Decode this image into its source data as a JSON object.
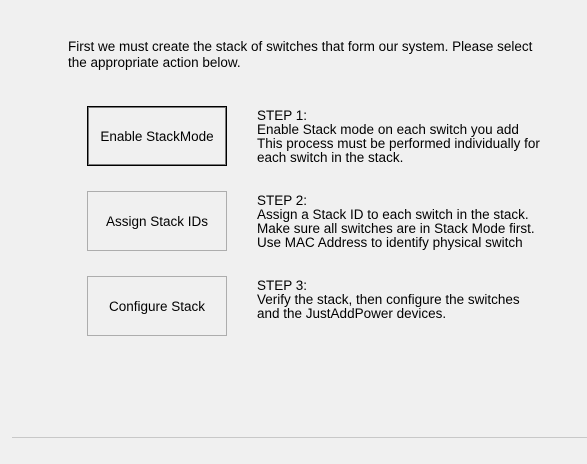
{
  "intro": {
    "line1": "First we must create the stack of switches that form our system. Please select",
    "line2": "the appropriate action below."
  },
  "steps": [
    {
      "button_label": "Enable StackMode",
      "heading": "STEP 1:",
      "lines": [
        "Enable Stack mode on each switch you add",
        "This process must be performed individually for",
        "each switch in the stack."
      ]
    },
    {
      "button_label": "Assign Stack IDs",
      "heading": "STEP 2:",
      "lines": [
        "Assign a Stack ID to each switch in the stack.",
        "Make sure all switches are in Stack Mode first.",
        "Use MAC Address to identify physical switch"
      ]
    },
    {
      "button_label": "Configure Stack",
      "heading": "STEP 3:",
      "lines": [
        "Verify the stack, then configure the switches",
        "and the JustAddPower devices."
      ]
    }
  ]
}
